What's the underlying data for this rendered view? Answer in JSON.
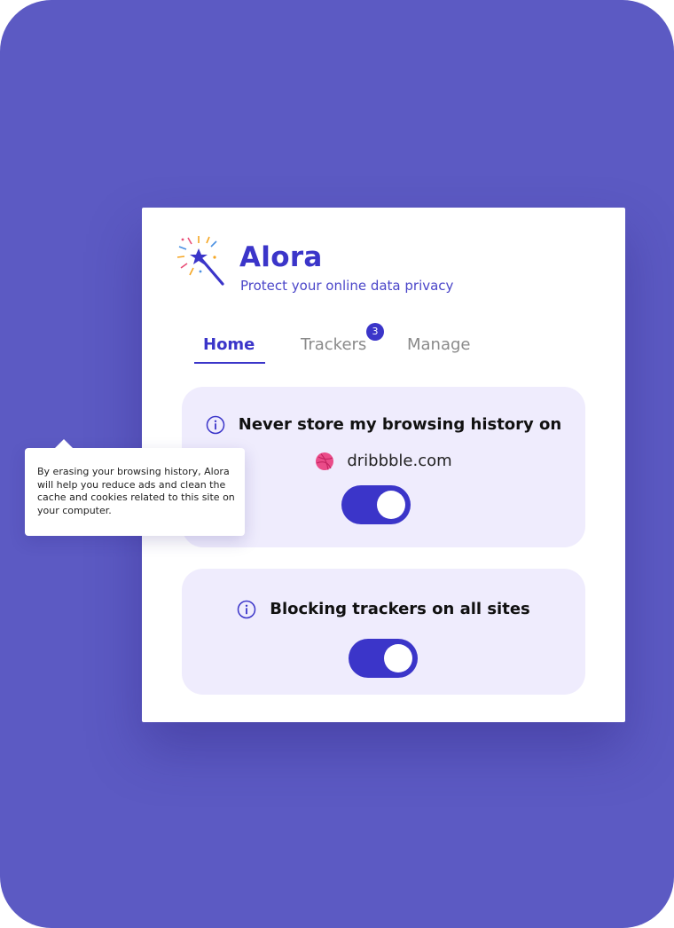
{
  "app": {
    "title": "Alora",
    "subtitle": "Protect your online data privacy",
    "logo_icon": "magic-wand-icon"
  },
  "tabs": [
    {
      "label": "Home",
      "active": true
    },
    {
      "label": "Trackers",
      "badge": "3"
    },
    {
      "label": "Manage"
    }
  ],
  "cards": [
    {
      "title": "Never store my browsing history on",
      "site": "dribbble.com",
      "site_icon": "dribbble-icon",
      "toggle_on": true
    },
    {
      "title": "Blocking trackers on all sites",
      "toggle_on": true
    }
  ],
  "tooltip": {
    "text": "By erasing your browsing history, Alora will help you reduce ads and clean the cache and cookies related to this site on your computer."
  },
  "colors": {
    "background": "#5c5ac3",
    "accent": "#3b35c9",
    "card": "#efecfd",
    "dribbble": "#ea4c89"
  }
}
